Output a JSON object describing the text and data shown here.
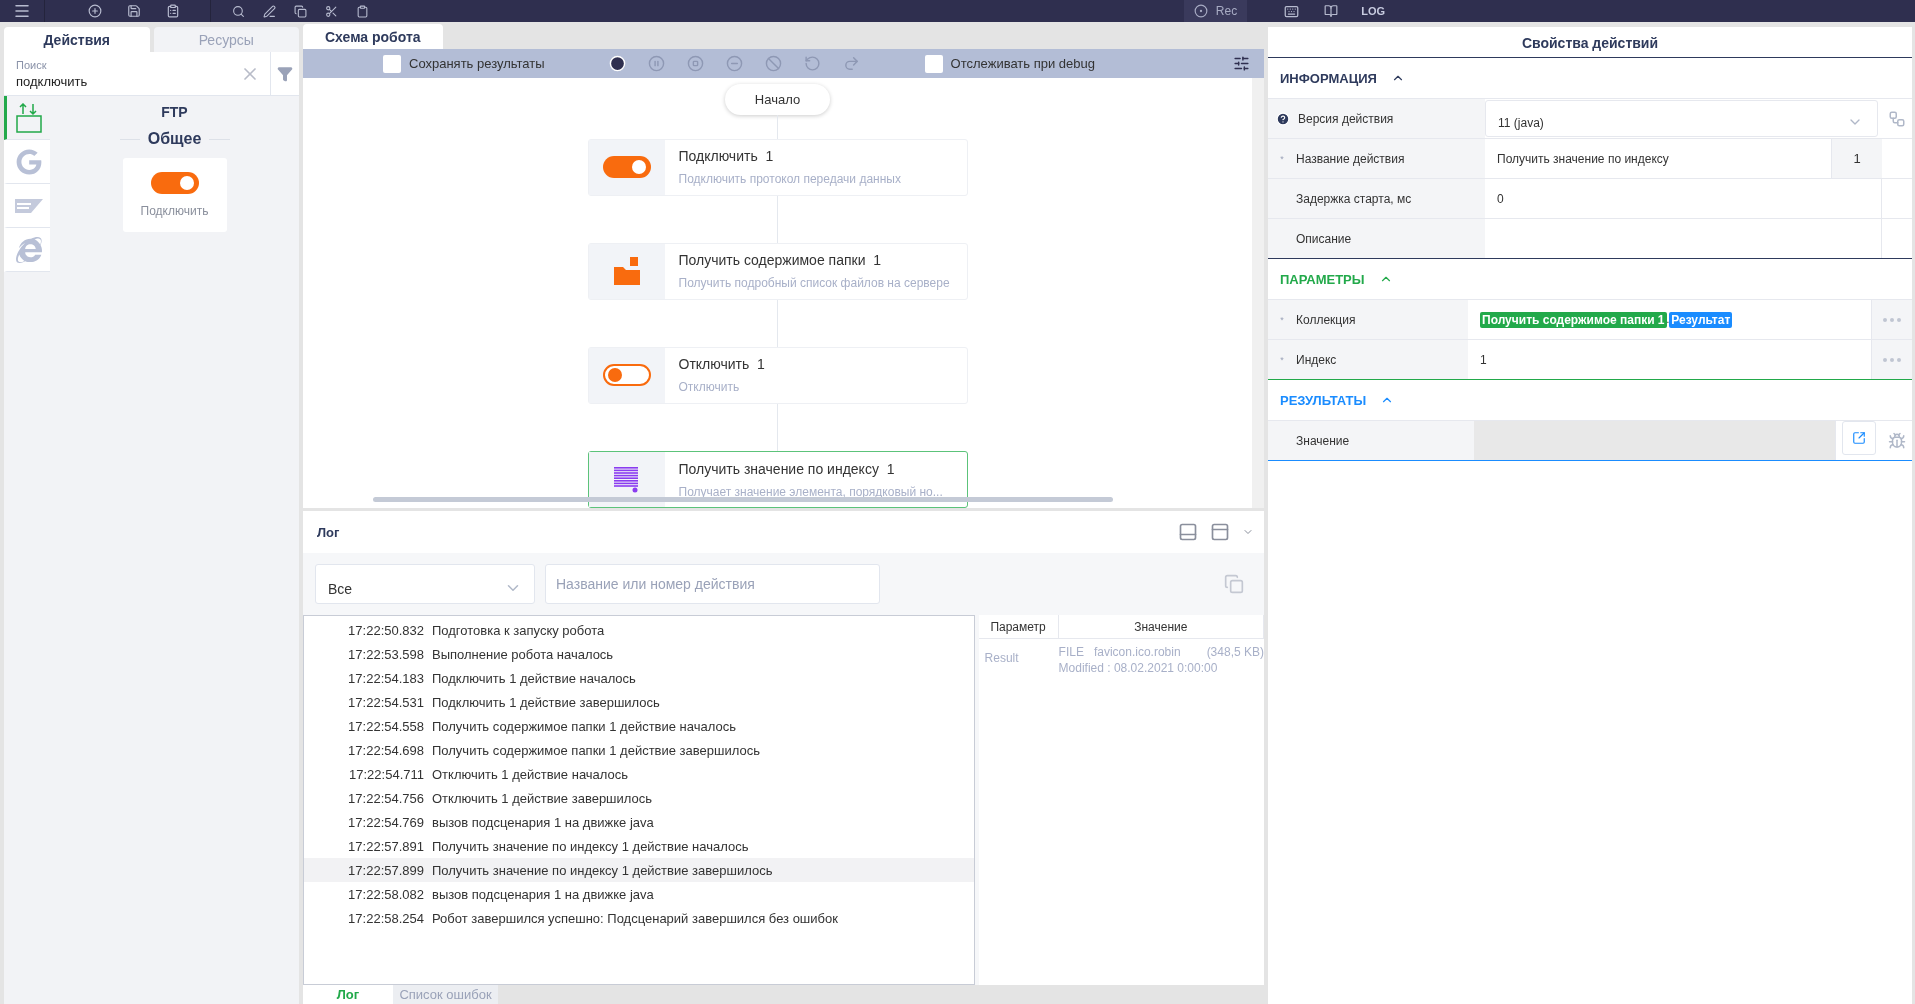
{
  "top_bar": {
    "rec": "Rec",
    "log": "LOG"
  },
  "left_panel": {
    "tabs": [
      {
        "label": "Действия",
        "selected": true
      },
      {
        "label": "Ресурсы",
        "selected": false
      }
    ],
    "search": {
      "label": "Поиск",
      "value": "подключить"
    },
    "categories": [
      {
        "kind": "ftp",
        "selected": true
      },
      {
        "kind": "google",
        "selected": false
      },
      {
        "kind": "sap",
        "selected": false
      },
      {
        "kind": "browser",
        "selected": false
      }
    ],
    "category_title": "FTP",
    "group_title": "Общее",
    "actions": [
      {
        "kind": "connect",
        "label": "Подключить"
      }
    ]
  },
  "schema": {
    "tab": "Схема робота",
    "save_results": {
      "label": "Сохранять результаты",
      "checked": false
    },
    "debug": {
      "label": "Отслеживать при debug",
      "checked": false
    },
    "start": "Начало",
    "nodes": [
      {
        "kind": "connect",
        "title": "Подключить",
        "number": "1",
        "description": "Подключить протокол передачи данных",
        "selected": false
      },
      {
        "kind": "folder",
        "title": "Получить содержимое папки",
        "number": "1",
        "description": "Получить подробный список файлов на сервере",
        "selected": false
      },
      {
        "kind": "disconnect",
        "title": "Отключить",
        "number": "1",
        "description": "Отключить",
        "selected": false
      },
      {
        "kind": "list",
        "title": "Получить значение по индексу",
        "number": "1",
        "description": "Получает значение элемента, порядковый но...",
        "selected": true
      }
    ]
  },
  "log": {
    "title": "Лог",
    "filter": {
      "value": "Все"
    },
    "search": {
      "placeholder": "Название или номер действия"
    },
    "entries": [
      {
        "time": "17:22:50.832",
        "message": "Подготовка к запуску робота",
        "selected": false
      },
      {
        "time": "17:22:53.598",
        "message": "Выполнение робота началось",
        "selected": false
      },
      {
        "time": "17:22:54.183",
        "message": "Подключить 1 действие началось",
        "selected": false
      },
      {
        "time": "17:22:54.531",
        "message": "Подключить 1 действие завершилось",
        "selected": false
      },
      {
        "time": "17:22:54.558",
        "message": "Получить содержимое папки 1 действие началось",
        "selected": false
      },
      {
        "time": "17:22:54.698",
        "message": "Получить содержимое папки 1 действие завершилось",
        "selected": false
      },
      {
        "time": "17:22:54.711",
        "message": "Отключить 1 действие началось",
        "selected": false
      },
      {
        "time": "17:22:54.756",
        "message": "Отключить 1 действие завершилось",
        "selected": false
      },
      {
        "time": "17:22:54.769",
        "message": "вызов подсценария 1 на движке java",
        "selected": false
      },
      {
        "time": "17:22:57.891",
        "message": "Получить значение по индексу 1 действие началось",
        "selected": false
      },
      {
        "time": "17:22:57.899",
        "message": "Получить значение по индексу 1 действие завершилось",
        "selected": true
      },
      {
        "time": "17:22:58.082",
        "message": "вызов подсценария 1 на движке java",
        "selected": false
      },
      {
        "time": "17:22:58.254",
        "message": "Робот завершился успешно: Подсценарий завершился без ошибок",
        "selected": false
      }
    ],
    "params": {
      "columns": [
        "Параметр",
        "Значение"
      ],
      "rows": [
        {
          "parameter": "Result",
          "type": "FILE",
          "name": "favicon.ico.robin",
          "size": "(348,5 KB)",
          "modified": "Modified : 08.02.2021 0:00:00"
        }
      ]
    },
    "tabs": [
      {
        "label": "Лог",
        "selected": true
      },
      {
        "label": "Список ошибок",
        "selected": false
      }
    ]
  },
  "properties": {
    "title": "Свойства действий",
    "sections": [
      {
        "title": "ИНФОРМАЦИЯ",
        "color": "#2e3a5c",
        "expanded": true,
        "rows": [
          {
            "kind": "select",
            "help": true,
            "label": "Версия действия",
            "value": "11 (java)"
          },
          {
            "kind": "text",
            "marker": "*",
            "label": "Название действия",
            "value": "Получить значение по индексу",
            "suffix": "1"
          },
          {
            "kind": "text",
            "label": "Задержка старта, мс",
            "value": "0"
          },
          {
            "kind": "text",
            "label": "Описание"
          }
        ]
      },
      {
        "title": "ПАРАМЕТРЫ",
        "color": "#22a94a",
        "expanded": true,
        "rows": [
          {
            "kind": "tokens",
            "marker": "*",
            "label": "Коллекция",
            "tokens": [
              {
                "text": "Получить содержимое папки 1",
                "color": "#22a94a"
              },
              {
                "text": "Результат",
                "color": "#1a8cff"
              }
            ],
            "separator": "."
          },
          {
            "kind": "param",
            "marker": "*",
            "label": "Индекс",
            "value": "1"
          }
        ]
      },
      {
        "title": "РЕЗУЛЬТАТЫ",
        "color": "#1a8cff",
        "expanded": true,
        "rows": [
          {
            "kind": "result",
            "label": "Значение"
          }
        ]
      }
    ]
  }
}
